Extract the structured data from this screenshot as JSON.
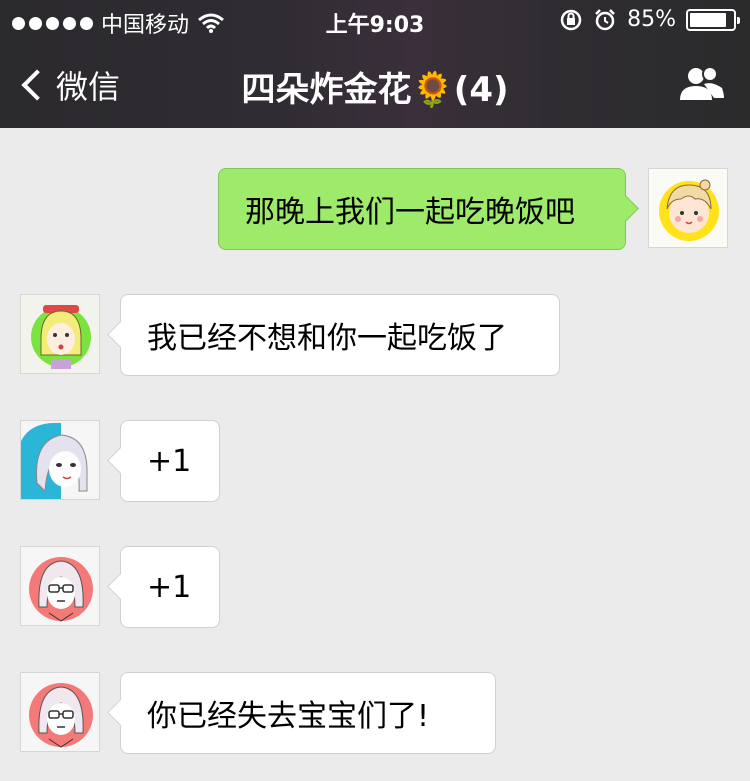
{
  "status_bar": {
    "carrier": "中国移动",
    "time": "上午9:03",
    "battery_text": "85%",
    "battery_level": 0.85,
    "icons": [
      "signal-dots-icon",
      "wifi-icon",
      "rotation-lock-icon",
      "alarm-icon",
      "battery-icon"
    ]
  },
  "nav": {
    "back_label": "微信",
    "title": "四朵炸金花🌻(4)",
    "right_icon": "group-members-icon"
  },
  "messages": [
    {
      "side": "outgoing",
      "text": "那晚上我们一起吃晚饭吧",
      "avatar": "blonde-girl-avatar"
    },
    {
      "side": "incoming",
      "text": "我已经不想和你一起吃饭了",
      "avatar": "green-bg-girl-avatar"
    },
    {
      "side": "incoming",
      "text": "+1",
      "avatar": "blue-bg-girl-avatar"
    },
    {
      "side": "incoming",
      "text": "+1",
      "avatar": "glasses-girl-avatar"
    },
    {
      "side": "incoming",
      "text": "你已经失去宝宝们了!",
      "avatar": "glasses-girl-avatar"
    }
  ],
  "colors": {
    "header_bg": "#2e2c30",
    "chat_bg": "#ebebeb",
    "outgoing_bubble": "#9eea6a",
    "incoming_bubble": "#ffffff"
  }
}
